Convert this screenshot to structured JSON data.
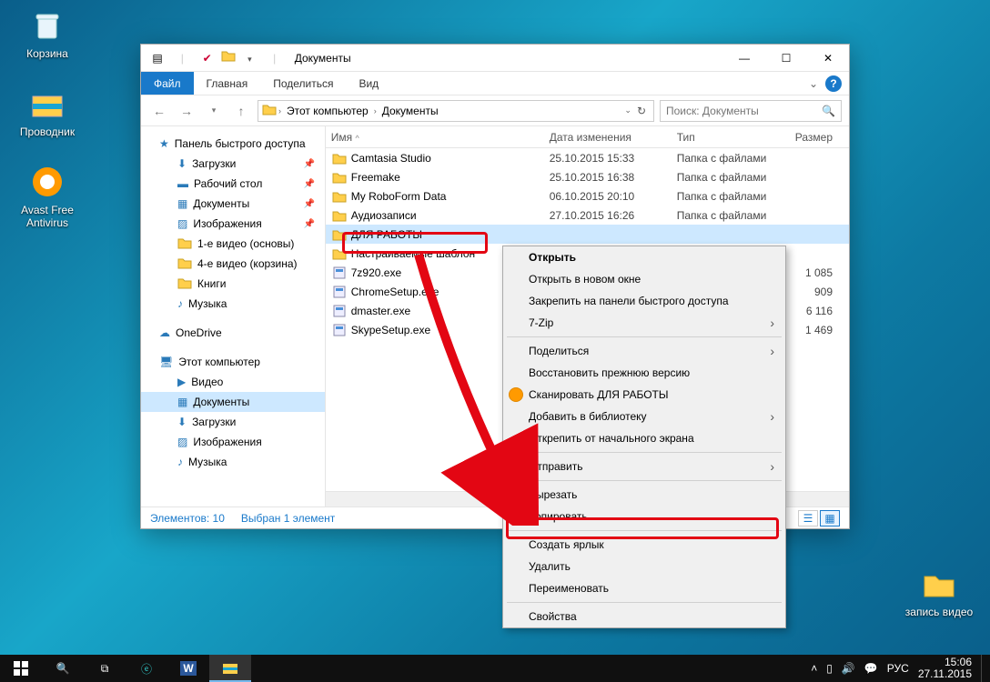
{
  "desktop": {
    "recycle": "Корзина",
    "explorer": "Проводник",
    "avast": "Avast Free Antivirus",
    "record": "запись видео"
  },
  "window": {
    "title": "Документы",
    "tabs": {
      "file": "Файл",
      "home": "Главная",
      "share": "Поделиться",
      "view": "Вид"
    },
    "breadcrumbs": {
      "pc": "Этот компьютер",
      "docs": "Документы"
    },
    "search_placeholder": "Поиск: Документы",
    "columns": {
      "name": "Имя",
      "date": "Дата изменения",
      "type": "Тип",
      "size": "Размер"
    },
    "status": {
      "count": "Элементов: 10",
      "selected": "Выбран 1 элемент"
    }
  },
  "tree": {
    "quick": "Панель быстрого доступа",
    "downloads": "Загрузки",
    "desktop": "Рабочий стол",
    "documents": "Документы",
    "pictures": "Изображения",
    "vid1": "1-е видео (основы)",
    "vid4": "4-е видео (корзина)",
    "books": "Книги",
    "music": "Музыка",
    "onedrive": "OneDrive",
    "thispc": "Этот компьютер",
    "videos": "Видео",
    "documents2": "Документы",
    "downloads2": "Загрузки",
    "pictures2": "Изображения",
    "music2": "Музыка"
  },
  "files": [
    {
      "name": "Camtasia Studio",
      "date": "25.10.2015 15:33",
      "type": "Папка с файлами",
      "size": "",
      "icon": "folder"
    },
    {
      "name": "Freemake",
      "date": "25.10.2015 16:38",
      "type": "Папка с файлами",
      "size": "",
      "icon": "folder"
    },
    {
      "name": "My RoboForm Data",
      "date": "06.10.2015 20:10",
      "type": "Папка с файлами",
      "size": "",
      "icon": "folder"
    },
    {
      "name": "Аудиозаписи",
      "date": "27.10.2015 16:26",
      "type": "Папка с файлами",
      "size": "",
      "icon": "folder"
    },
    {
      "name": "ДЛЯ РАБОТЫ",
      "date": "",
      "type": "",
      "size": "",
      "icon": "folder"
    },
    {
      "name": "Настраиваемые шаблон",
      "date": "",
      "type": "",
      "size": "",
      "icon": "folder"
    },
    {
      "name": "7z920.exe",
      "date": "",
      "type": "",
      "size": "1 085",
      "icon": "exe"
    },
    {
      "name": "ChromeSetup.exe",
      "date": "",
      "type": "",
      "size": "909",
      "icon": "exe"
    },
    {
      "name": "dmaster.exe",
      "date": "",
      "type": "",
      "size": "6 116",
      "icon": "exe"
    },
    {
      "name": "SkypeSetup.exe",
      "date": "",
      "type": "",
      "size": "1 469",
      "icon": "exe"
    }
  ],
  "ctx": {
    "open": "Открыть",
    "open_new": "Открыть в новом окне",
    "pin_quick": "Закрепить на панели быстрого доступа",
    "sevenzip": "7-Zip",
    "share": "Поделиться",
    "restore": "Восстановить прежнюю версию",
    "scan": "Сканировать ДЛЯ РАБОТЫ",
    "library": "Добавить в библиотеку",
    "unpin_start": "Открепить от начального экрана",
    "send": "Отправить",
    "cut": "Вырезать",
    "copy": "Копировать",
    "shortcut": "Создать ярлык",
    "delete": "Удалить",
    "rename": "Переименовать",
    "props": "Свойства"
  },
  "taskbar": {
    "lang": "РУС",
    "time": "15:06",
    "date": "27.11.2015"
  }
}
